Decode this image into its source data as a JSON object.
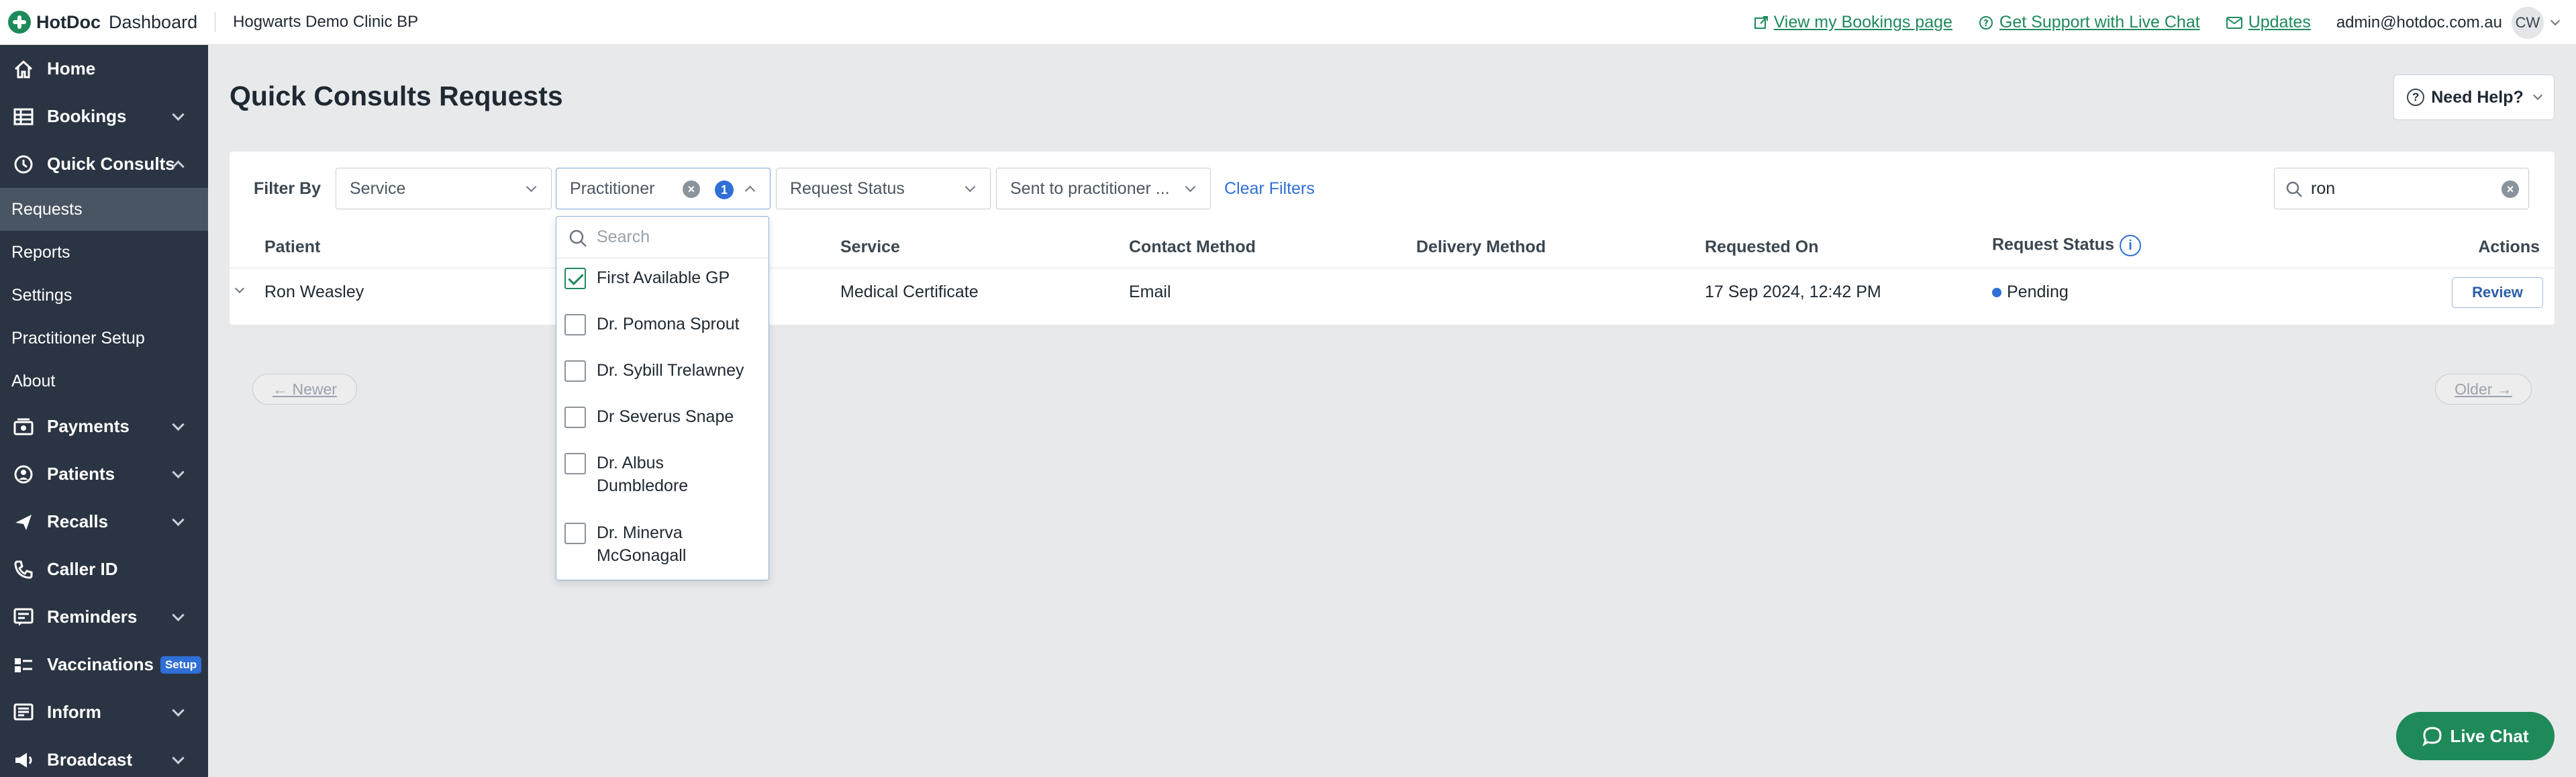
{
  "topbar": {
    "brand": "HotDoc",
    "brand_sub": "Dashboard",
    "clinic": "Hogwarts Demo Clinic BP",
    "links": {
      "bookings": "View my Bookings page",
      "support": "Get Support with Live Chat",
      "updates": "Updates"
    },
    "admin_email": "admin@hotdoc.com.au",
    "avatar_initials": "CW"
  },
  "sidebar": {
    "items": [
      {
        "label": "Home",
        "icon": "home-icon"
      },
      {
        "label": "Bookings",
        "icon": "bookings-icon"
      },
      {
        "label": "Quick Consults",
        "icon": "quick-consults-icon"
      }
    ],
    "sub_items": [
      "Requests",
      "Reports",
      "Settings",
      "Practitioner Setup",
      "About"
    ],
    "lower_items": [
      {
        "label": "Payments",
        "icon": "payments-icon"
      },
      {
        "label": "Patients",
        "icon": "patients-icon"
      },
      {
        "label": "Recalls",
        "icon": "recalls-icon"
      },
      {
        "label": "Caller ID",
        "icon": "phone-icon"
      },
      {
        "label": "Reminders",
        "icon": "reminders-icon"
      },
      {
        "label": "Vaccinations",
        "icon": "vaccinations-icon",
        "badge": "Setup"
      },
      {
        "label": "Inform",
        "icon": "inform-icon"
      },
      {
        "label": "Broadcast",
        "icon": "broadcast-icon"
      }
    ]
  },
  "page": {
    "title": "Quick Consults Requests",
    "need_help": "Need Help?"
  },
  "filters": {
    "label": "Filter By",
    "service": "Service",
    "practitioner": "Practitioner",
    "practitioner_count": "1",
    "request_status": "Request Status",
    "sent_to": "Sent to practitioner ...",
    "clear": "Clear Filters",
    "search_value": "ron"
  },
  "table": {
    "headers": {
      "patient": "Patient",
      "service": "Service",
      "contact": "Contact Method",
      "delivery": "Delivery Method",
      "requested": "Requested On",
      "status": "Request Status",
      "actions": "Actions"
    },
    "rows": [
      {
        "patient": "Ron Weasley",
        "service": "Medical Certificate",
        "contact": "Email",
        "delivery": "",
        "requested": "17 Sep 2024, 12:42 PM",
        "status": "Pending",
        "action": "Review"
      }
    ]
  },
  "pager": {
    "newer": "← Newer",
    "older": "Older →"
  },
  "dropdown": {
    "search_placeholder": "Search",
    "options": [
      {
        "label": "First Available GP",
        "checked": true
      },
      {
        "label": "Dr. Pomona Sprout",
        "checked": false
      },
      {
        "label": "Dr. Sybill Trelawney",
        "checked": false
      },
      {
        "label": "Dr Severus Snape",
        "checked": false
      },
      {
        "label": "Dr. Albus Dumbledore",
        "checked": false
      },
      {
        "label": "Dr. Minerva McGonagall",
        "checked": false
      }
    ]
  },
  "live_chat": "Live Chat",
  "colors": {
    "brand_green": "#1e8a5a",
    "sidebar_bg": "#2a3442",
    "accent_blue": "#2f6fd6"
  }
}
